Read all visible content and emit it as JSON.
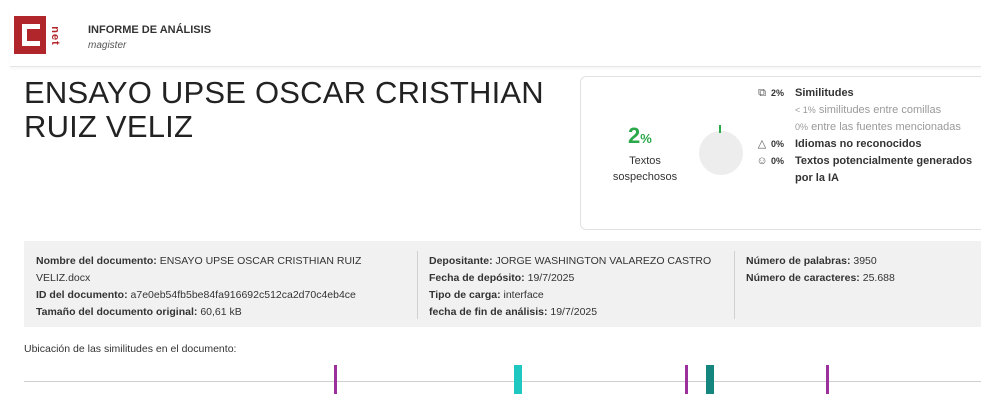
{
  "header": {
    "logo_text": "net",
    "title": "INFORME DE ANÁLISIS",
    "subtitle": "magister"
  },
  "document_title": "ENSAYO UPSE OSCAR CRISTHIAN RUIZ VELIZ",
  "summary": {
    "main_percent": "2",
    "main_percent_unit": "%",
    "main_label": "Textos sospechosos",
    "donut_fill_percent": 2,
    "similitudes": {
      "icon": "copy-icon",
      "percent": "2%",
      "label": "Similitudes"
    },
    "sub_quotes": {
      "percent": "< 1%",
      "label": "similitudes entre comillas"
    },
    "sub_sources": {
      "percent": "0%",
      "label": "entre las fuentes mencionadas"
    },
    "idiomas": {
      "icon": "language-icon",
      "percent": "0%",
      "label": "Idiomas no reconocidos"
    },
    "ia": {
      "icon": "ai-icon",
      "percent": "0%",
      "label": "Textos potencialmente generados por la IA"
    }
  },
  "info": {
    "col1": [
      {
        "key": "Nombre del documento:",
        "value": "ENSAYO UPSE OSCAR CRISTHIAN RUIZ VELIZ.docx"
      },
      {
        "key": "ID del documento:",
        "value": "a7e0eb54fb5be84fa916692c512ca2d70c4eb4ce"
      },
      {
        "key": "Tamaño del documento original:",
        "value": "60,61 kB"
      }
    ],
    "col2": [
      {
        "key": "Depositante:",
        "value": "JORGE WASHINGTON VALAREZO CASTRO"
      },
      {
        "key": "Fecha de depósito:",
        "value": "19/7/2025"
      },
      {
        "key": "Tipo de carga:",
        "value": "interface"
      },
      {
        "key": "fecha de fin de análisis:",
        "value": "19/7/2025"
      }
    ],
    "col3": [
      {
        "key": "Número de palabras:",
        "value": "3950"
      },
      {
        "key": "Número de caracteres:",
        "value": "25.688"
      }
    ]
  },
  "location": {
    "label": "Ubicación de las similitudes en el documento:",
    "markers": [
      {
        "position_pct": 32.6,
        "type": "similarity",
        "color": "#9b2f9b"
      },
      {
        "position_pct": 51.6,
        "type": "quote",
        "color": "#1ec7c0"
      },
      {
        "position_pct": 69.2,
        "type": "similarity",
        "color": "#9b2f9b"
      },
      {
        "position_pct": 71.7,
        "type": "source",
        "color": "#14857f"
      },
      {
        "position_pct": 84.0,
        "type": "similarity",
        "color": "#9b2f9b"
      }
    ]
  },
  "colors": {
    "brand": "#b1262b",
    "green": "#2aa84a",
    "panel_bg": "#f1f1f1"
  }
}
